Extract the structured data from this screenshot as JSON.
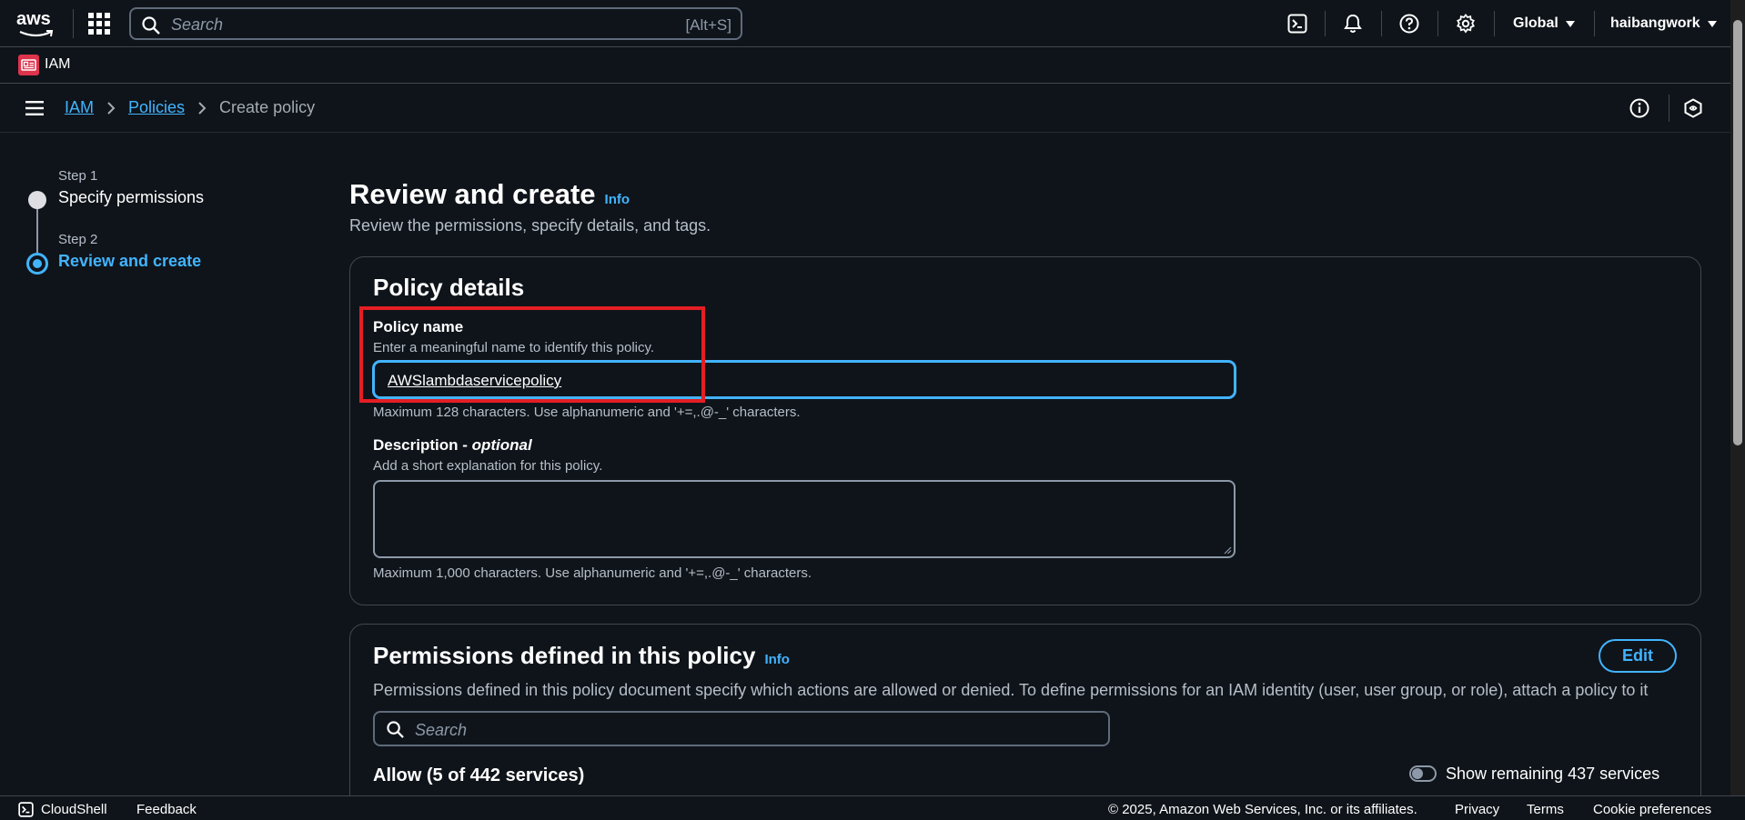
{
  "topnav": {
    "logo": "aws",
    "search_placeholder": "Search",
    "search_shortcut": "[Alt+S]",
    "region": "Global",
    "account": "haibangwork",
    "icons": [
      "cloudshell-icon",
      "bell-icon",
      "help-icon",
      "gear-icon"
    ]
  },
  "servicebar": {
    "service_name": "IAM"
  },
  "breadcrumb": {
    "items": [
      {
        "label": "IAM",
        "link": true
      },
      {
        "label": "Policies",
        "link": true
      },
      {
        "label": "Create policy",
        "link": false
      }
    ]
  },
  "steps": [
    {
      "step": "Step 1",
      "label": "Specify permissions",
      "state": "complete"
    },
    {
      "step": "Step 2",
      "label": "Review and create",
      "state": "active"
    }
  ],
  "page": {
    "title": "Review and create",
    "info": "Info",
    "subtitle": "Review the permissions, specify details, and tags."
  },
  "policy_details": {
    "heading": "Policy details",
    "name_label": "Policy name",
    "name_hint": "Enter a meaningful name to identify this policy.",
    "name_value": "AWSlambdaservicepolicy",
    "name_constraint": "Maximum 128 characters. Use alphanumeric and '+=,.@-_' characters.",
    "desc_label": "Description - ",
    "desc_optional": "optional",
    "desc_hint": "Add a short explanation for this policy.",
    "desc_value": "",
    "desc_constraint": "Maximum 1,000 characters. Use alphanumeric and '+=,.@-_' characters."
  },
  "permissions": {
    "heading": "Permissions defined in this policy",
    "info": "Info",
    "edit_label": "Edit",
    "description": "Permissions defined in this policy document specify which actions are allowed or denied. To define permissions for an IAM identity (user, user group, or role), attach a policy to it",
    "search_placeholder": "Search",
    "allow_label": "Allow (5 of 442 services)",
    "toggle_label": "Show remaining 437 services",
    "toggle_on": false
  },
  "footer": {
    "cloudshell": "CloudShell",
    "feedback": "Feedback",
    "copyright": "© 2025, Amazon Web Services, Inc. or its affiliates.",
    "privacy": "Privacy",
    "terms": "Terms",
    "cookies": "Cookie preferences"
  },
  "colors": {
    "background": "#0f141a",
    "link": "#42b4ff",
    "border": "#424650",
    "iam_badge": "#dd344c",
    "annotation": "#e31e24"
  }
}
